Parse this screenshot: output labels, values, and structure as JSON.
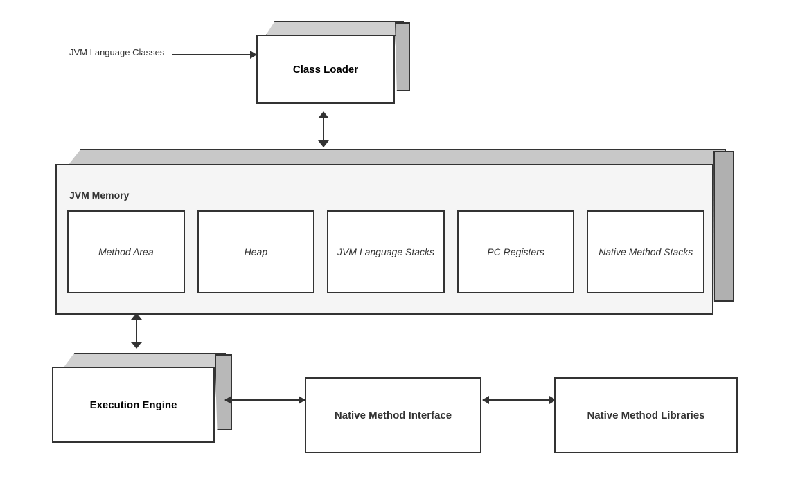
{
  "classLoader": {
    "label": "Class Loader"
  },
  "jvmLangLabel": "JVM Language Classes",
  "jvmMemory": {
    "label": "JVM Memory",
    "boxes": [
      {
        "label": "Method Area"
      },
      {
        "label": "Heap"
      },
      {
        "label": "JVM Language Stacks"
      },
      {
        "label": "PC Registers"
      },
      {
        "label": "Native Method Stacks"
      }
    ]
  },
  "executionEngine": {
    "label": "Execution Engine"
  },
  "nativeMethodInterface": {
    "label": "Native Method Interface"
  },
  "nativeMethodLibraries": {
    "label": "Native Method Libraries"
  }
}
